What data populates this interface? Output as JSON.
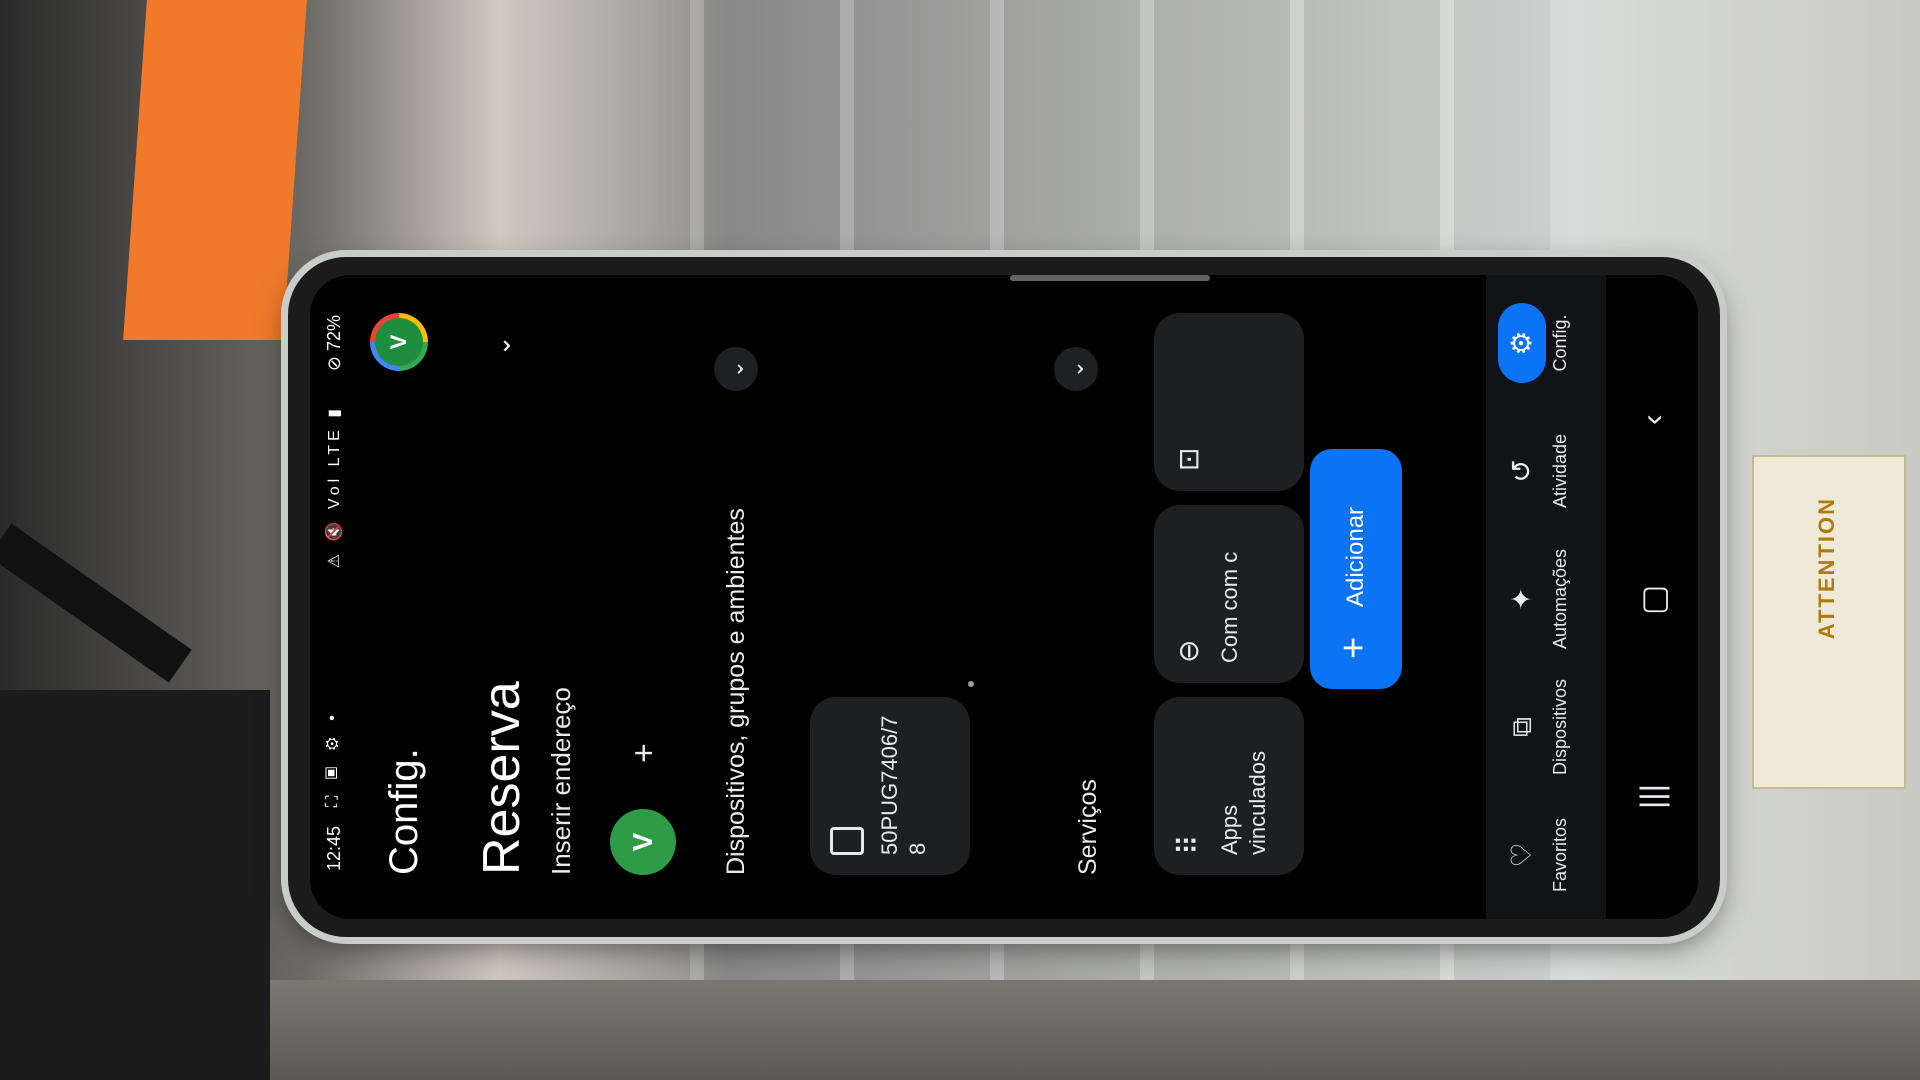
{
  "status_bar": {
    "time": "12:45",
    "left_icons": "⛶ ▣ ⚙ •",
    "right_icons": "⚠ 🔇 Vol LTE ▮",
    "battery": "⊘ 72%"
  },
  "header": {
    "title": "Config.",
    "account_initial": "V"
  },
  "home": {
    "name": "Reserva",
    "address": "Inserir endereço"
  },
  "members": {
    "member_initial": "V",
    "add_symbol": "+"
  },
  "devices_section": {
    "title": "Dispositivos, grupos e ambientes",
    "device_card": {
      "name": "50PUG7406/78",
      "icon": "device-icon"
    }
  },
  "services_section": {
    "title": "Serviços",
    "cards": [
      {
        "label": "Apps vinculados",
        "icon": "apps-grid-icon",
        "glyph": "⠿"
      },
      {
        "label": "Com com c",
        "icon": "link-icon",
        "glyph": "⊖"
      },
      {
        "label": "",
        "icon": "media-icon",
        "glyph": "⊡"
      }
    ]
  },
  "fab": {
    "plus": "+",
    "label": "Adicionar"
  },
  "bottom_nav": [
    {
      "label": "Favoritos",
      "icon": "heart-icon",
      "glyph": "♡"
    },
    {
      "label": "Dispositivos",
      "icon": "devices-icon",
      "glyph": "⧉"
    },
    {
      "label": "Automações",
      "icon": "sparkle-icon",
      "glyph": "✦"
    },
    {
      "label": "Atividade",
      "icon": "history-icon",
      "glyph": "↺"
    },
    {
      "label": "Config.",
      "icon": "gear-icon",
      "glyph": "⚙",
      "active": true
    }
  ],
  "system_nav": {
    "recents": "|||",
    "home": "▢",
    "back": "‹"
  },
  "chevron": "⌄",
  "colors": {
    "accent": "#0b73f5",
    "avatar_green": "#2e9b46",
    "card_bg": "#1e1f22",
    "screen_bg": "#000000"
  }
}
